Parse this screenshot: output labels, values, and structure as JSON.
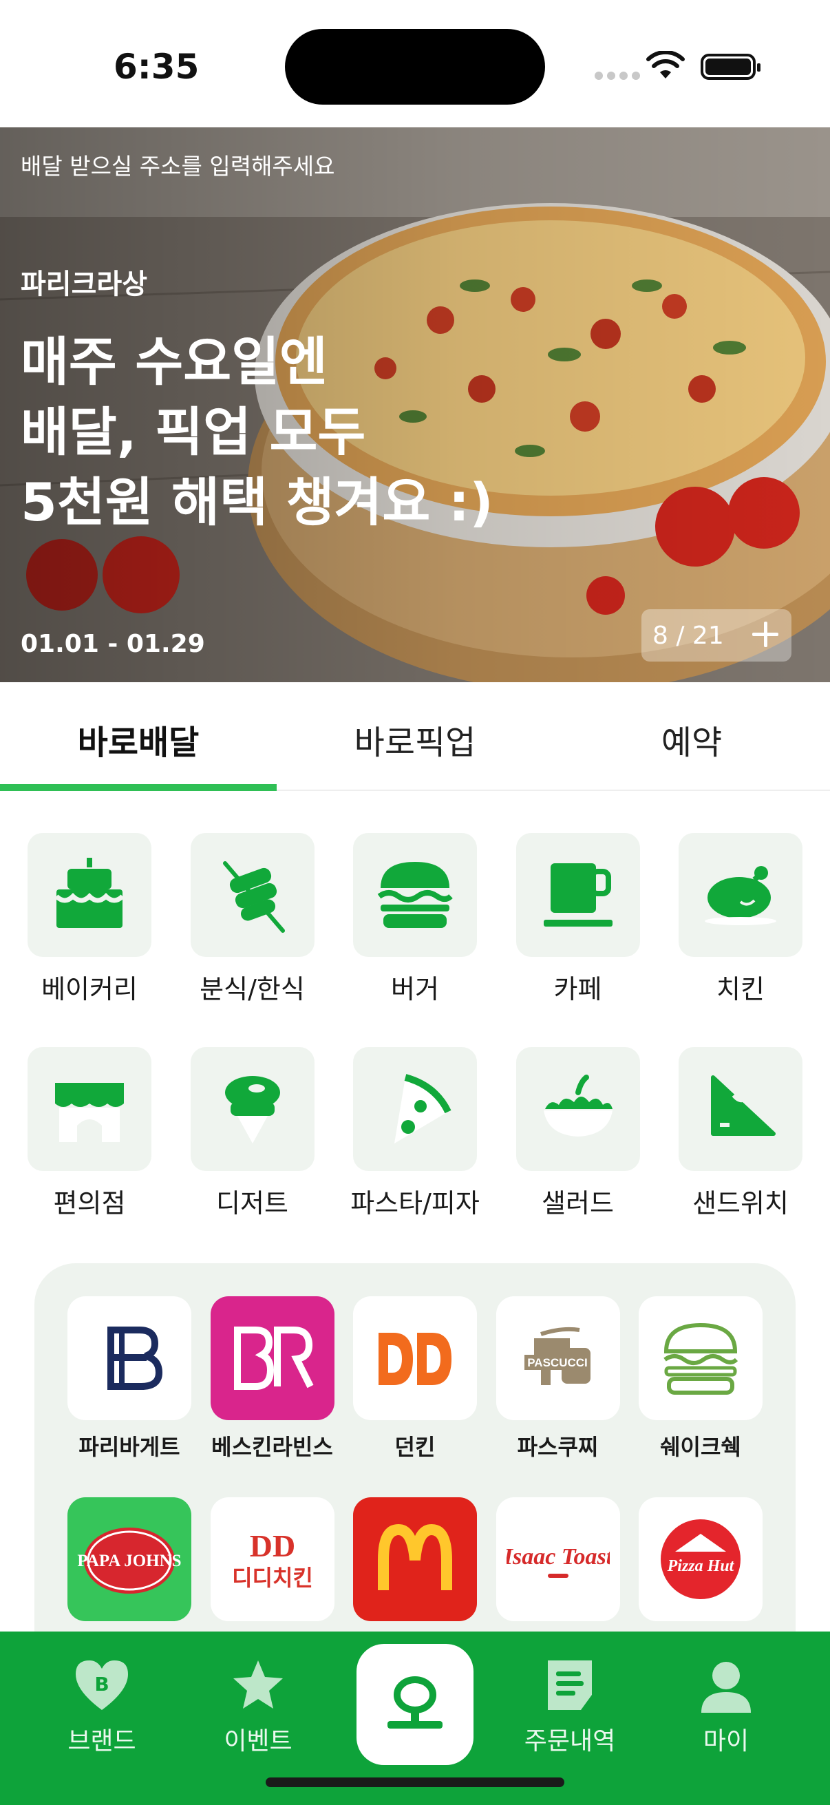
{
  "status": {
    "time": "6:35"
  },
  "hero": {
    "address_prompt": "배달 받으실 주소를 입력해주세요",
    "brand": "파리크라상",
    "headline": [
      "매주 수요일엔",
      "배달, 픽업 모두",
      "5천원 해택 챙겨요 :)"
    ],
    "period": "01.01 - 01.29",
    "pager": "8 / 21"
  },
  "tabs": [
    {
      "label": "바로배달",
      "active": true
    },
    {
      "label": "바로픽업",
      "active": false
    },
    {
      "label": "예약",
      "active": false
    }
  ],
  "categories": [
    {
      "label": "베이커리",
      "icon": "cake-icon"
    },
    {
      "label": "분식/한식",
      "icon": "skewer-icon"
    },
    {
      "label": "버거",
      "icon": "burger-icon"
    },
    {
      "label": "카페",
      "icon": "coffee-cup-icon"
    },
    {
      "label": "치킨",
      "icon": "chicken-icon"
    },
    {
      "label": "편의점",
      "icon": "store-icon"
    },
    {
      "label": "디저트",
      "icon": "ice-cream-icon"
    },
    {
      "label": "파스타/피자",
      "icon": "pizza-slice-icon"
    },
    {
      "label": "샐러드",
      "icon": "salad-icon"
    },
    {
      "label": "샌드위치",
      "icon": "sandwich-icon"
    }
  ],
  "brands": [
    {
      "label": "파리바게트",
      "logo": "paris-baguette-logo"
    },
    {
      "label": "베스킨라빈스",
      "logo": "baskin-robbins-logo"
    },
    {
      "label": "던킨",
      "logo": "dunkin-logo"
    },
    {
      "label": "파스쿠찌",
      "logo": "pascucci-logo",
      "logo_text": "PASCUCCI"
    },
    {
      "label": "쉐이크쉑",
      "logo": "shake-shack-logo"
    },
    {
      "label": "",
      "logo": "papa-johns-logo",
      "logo_text": "PAPA JOHNS"
    },
    {
      "label": "",
      "logo": "didi-chicken-logo",
      "logo_text": "디디치킨"
    },
    {
      "label": "",
      "logo": "mcdonalds-logo"
    },
    {
      "label": "",
      "logo": "isaac-toast-logo",
      "logo_text": "Isaac Toast"
    },
    {
      "label": "",
      "logo": "pizza-hut-logo",
      "logo_text": "Pizza Hut"
    }
  ],
  "bottom_nav": [
    {
      "label": "브랜드",
      "icon": "heart-b-icon"
    },
    {
      "label": "이벤트",
      "icon": "star-icon"
    },
    {
      "label": "",
      "icon": "home-o-icon"
    },
    {
      "label": "주문내역",
      "icon": "receipt-icon"
    },
    {
      "label": "마이",
      "icon": "person-icon"
    }
  ],
  "colors": {
    "accent": "#2fbf55",
    "nav": "#0ea33a",
    "icon_green": "#11a83a",
    "category_bg": "#eff4ef"
  }
}
